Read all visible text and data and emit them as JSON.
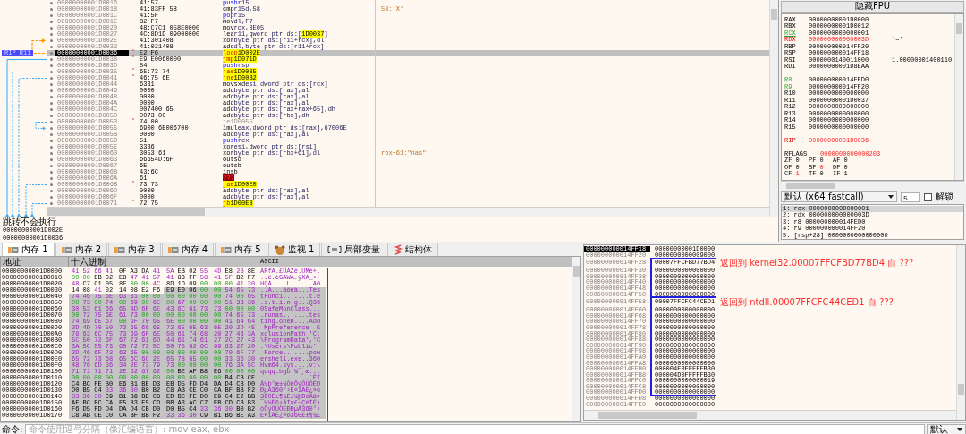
{
  "disassembly": {
    "rip_label": "RIP R11",
    "rows": [
      {
        "address": "00000000001D0016",
        "bytes": "41:57",
        "mnemonic": "push",
        "operands": "r15",
        "kind": "stack",
        "selected": false
      },
      {
        "address": "00000000001D0018",
        "bytes": "41:83FF 58",
        "mnemonic": "cmp",
        "operands": "r15d,58",
        "kind": "plain",
        "selected": false,
        "comment": "58:'X'"
      },
      {
        "address": "00000000001D001C",
        "bytes": "41:5F",
        "mnemonic": "pop",
        "operands": "r15",
        "kind": "stack",
        "selected": false
      },
      {
        "address": "00000000001D001E",
        "bytes": "B2 F7",
        "mnemonic": "mov",
        "operands": "dl,F7",
        "kind": "plain",
        "selected": false
      },
      {
        "address": "00000000001D0020",
        "bytes": "48:C7C1 058E0000",
        "mnemonic": "mov",
        "operands": "rcx,8E05",
        "kind": "plain",
        "selected": false
      },
      {
        "address": "00000000001D0027",
        "bytes": "4C:8D1D 09000000",
        "mnemonic": "lea",
        "operands": "r11,qword ptr ds:[",
        "target": "1D0037",
        "suffix": "]",
        "kind": "plain",
        "selected": false
      },
      {
        "address": "00000000001D002E",
        "bytes": "41:301408",
        "mnemonic": "xor",
        "operands": "byte ptr ds:[r11+rcx],dl",
        "kind": "plain",
        "selected": false
      },
      {
        "address": "00000000001D0032",
        "bytes": "41:021408",
        "mnemonic": "add",
        "operands": "dl,byte ptr ds:[r11+rcx]",
        "kind": "plain",
        "selected": false
      },
      {
        "address": "00000000001D0036",
        "bytes": "E2 F6",
        "mnemonic": "loop",
        "target": "1D002E",
        "kind": "jump",
        "branch": "˄",
        "selected": true
      },
      {
        "address": "00000000001D0038",
        "bytes": "E9 E0060000",
        "mnemonic": "jmp",
        "target": "1D071D",
        "kind": "jump",
        "branch": "˅",
        "selected": false
      },
      {
        "address": "00000000001D003D",
        "bytes": "54",
        "mnemonic": "push",
        "operands": "rsp",
        "kind": "stack",
        "selected": false
      },
      {
        "address": "00000000001D003E",
        "bytes": "65:73 74",
        "mnemonic": "jae",
        "target": "1D0085",
        "kind": "jump",
        "branch": "˅",
        "selected": false
      },
      {
        "address": "00000000001D0041",
        "bytes": "46:75 6E",
        "mnemonic": "jne",
        "target": "1D00B2",
        "kind": "jump",
        "branch": "˅",
        "selected": false
      },
      {
        "address": "00000000001D0044",
        "bytes": "6331",
        "mnemonic": "movsxd",
        "operands": "esi,dword ptr ds:[rcx]",
        "kind": "plain",
        "selected": false
      },
      {
        "address": "00000000001D0046",
        "bytes": "0000",
        "mnemonic": "add",
        "operands": "byte ptr ds:[rax],al",
        "kind": "plain",
        "selected": false
      },
      {
        "address": "00000000001D0048",
        "bytes": "0000",
        "mnemonic": "add",
        "operands": "byte ptr ds:[rax],al",
        "kind": "plain",
        "selected": false
      },
      {
        "address": "00000000001D004A",
        "bytes": "0000",
        "mnemonic": "add",
        "operands": "byte ptr ds:[rax],al",
        "kind": "plain",
        "selected": false
      },
      {
        "address": "00000000001D004C",
        "bytes": "007400 65",
        "mnemonic": "add",
        "operands": "byte ptr ds:[rax+rax+65],dh",
        "kind": "plain",
        "selected": false
      },
      {
        "address": "00000000001D0050",
        "bytes": "0073 00",
        "mnemonic": "add",
        "operands": "byte ptr ds:[rbx],dh",
        "kind": "plain",
        "selected": false
      },
      {
        "address": "00000000001D0053",
        "bytes": "74 00",
        "mnemonic": "je",
        "operands": "1D0055",
        "kind": "dead_jump",
        "branch": "˅",
        "selected": false
      },
      {
        "address": "00000000001D0055",
        "bytes": "6900 6E006700",
        "mnemonic": "imul",
        "operands": "eax,dword ptr ds:[rax],67006E",
        "kind": "plain",
        "selected": false
      },
      {
        "address": "00000000001D005B",
        "bytes": "0000",
        "mnemonic": "add",
        "operands": "byte ptr ds:[rax],al",
        "kind": "plain",
        "selected": false
      },
      {
        "address": "00000000001D005D",
        "bytes": "51",
        "mnemonic": "push",
        "operands": "rcx",
        "kind": "stack",
        "selected": false
      },
      {
        "address": "00000000001D005E",
        "bytes": "3336",
        "mnemonic": "xor",
        "operands": "esi,dword ptr ds:[rsi]",
        "kind": "plain",
        "selected": false
      },
      {
        "address": "00000000001D0060",
        "bytes": "3053 61",
        "mnemonic": "xor",
        "operands": "byte ptr ds:[rbx+61],dl",
        "kind": "plain",
        "selected": false,
        "comment": "rbx+61:\"nas\""
      },
      {
        "address": "00000000001D0063",
        "bytes": "66654D:6F",
        "mnemonic": "outsd",
        "kind": "plain",
        "selected": false
      },
      {
        "address": "00000000001D0067",
        "bytes": "6E",
        "mnemonic": "outsb",
        "kind": "plain",
        "selected": false
      },
      {
        "address": "00000000001D0068",
        "bytes": "43:6C",
        "mnemonic": "insb",
        "kind": "plain",
        "selected": false
      },
      {
        "address": "00000000001D006A",
        "bytes": "61",
        "mnemonic": "???",
        "kind": "invalid",
        "selected": false
      },
      {
        "address": "00000000001D006B",
        "bytes": "73 73",
        "mnemonic": "jae",
        "target": "1D00E0",
        "kind": "jump",
        "branch": "˅",
        "selected": false
      },
      {
        "address": "00000000001D006D",
        "bytes": "0000",
        "mnemonic": "add",
        "operands": "byte ptr ds:[rax],al",
        "kind": "plain",
        "selected": false
      },
      {
        "address": "00000000001D006F",
        "bytes": "0000",
        "mnemonic": "add",
        "operands": "byte ptr ds:[rax],al",
        "kind": "plain",
        "selected": false
      },
      {
        "address": "00000000001D0071",
        "bytes": "72 75",
        "mnemonic": "jb",
        "target": "1D00E8",
        "kind": "jump",
        "branch": "˅",
        "selected": false
      }
    ]
  },
  "info_panel": {
    "lines": [
      "跳转不会执行",
      "00000000001D002E",
      "00000000001D0036"
    ]
  },
  "registers": {
    "hide_fpu_button": "隐藏FPU",
    "groups": [
      [
        {
          "name": "RAX",
          "value": "00000000001D0000",
          "changed": false,
          "highlighted": false,
          "selected": false
        },
        {
          "name": "RBX",
          "value": "00000000001D0012",
          "changed": false,
          "highlighted": false,
          "selected": false
        },
        {
          "name": "RCX",
          "value": "0000000000000001",
          "changed": false,
          "highlighted": true,
          "selected": true
        },
        {
          "name": "RDX",
          "value": "000000000000003D",
          "comment": "'='",
          "changed": true,
          "highlighted": false,
          "selected": false
        },
        {
          "name": "RBP",
          "value": "000000000014FF20",
          "changed": false,
          "highlighted": false,
          "selected": false
        },
        {
          "name": "RSP",
          "value": "000000000014FF18",
          "changed": false,
          "highlighted": false,
          "selected": false
        },
        {
          "name": "RSI",
          "value": "0000000140011000",
          "comment": "1.00000001400110",
          "changed": false,
          "highlighted": false,
          "selected": false
        },
        {
          "name": "RDI",
          "value": "00000000001D8EAA",
          "changed": false,
          "highlighted": false,
          "selected": false
        }
      ],
      [
        {
          "name": "R8",
          "value": "000000000014FED0",
          "changed": false,
          "highlighted": true,
          "selected": false
        },
        {
          "name": "R9",
          "value": "000000000014FF20",
          "changed": false,
          "highlighted": true,
          "selected": false
        },
        {
          "name": "R10",
          "value": "0000000000000000",
          "changed": false,
          "highlighted": false,
          "selected": false
        },
        {
          "name": "R11",
          "value": "00000000001D0037",
          "changed": false,
          "highlighted": false,
          "selected": false
        },
        {
          "name": "R12",
          "value": "0000000000000000",
          "changed": false,
          "highlighted": false,
          "selected": false
        },
        {
          "name": "R13",
          "value": "0000000000000000",
          "changed": false,
          "highlighted": false,
          "selected": false
        },
        {
          "name": "R14",
          "value": "0000000000000000",
          "changed": false,
          "highlighted": false,
          "selected": false
        },
        {
          "name": "R15",
          "value": "0000000000000000",
          "changed": false,
          "highlighted": false,
          "selected": false
        }
      ],
      [
        {
          "name": "RIP",
          "value": "00000000001D0036",
          "changed": true,
          "highlighted": false,
          "selected": false
        }
      ]
    ],
    "rflags": {
      "name": "RFLAGS",
      "value": "0000000000000203",
      "changed": true
    },
    "flags": [
      {
        "name": "ZF",
        "value": "0",
        "changed": false
      },
      {
        "name": "PF",
        "value": "0",
        "changed": false
      },
      {
        "name": "AF",
        "value": "0",
        "changed": false
      },
      {
        "name": "OF",
        "value": "0",
        "changed": false
      },
      {
        "name": "SF",
        "value": "0",
        "changed": true
      },
      {
        "name": "DF",
        "value": "0",
        "changed": false
      },
      {
        "name": "CF",
        "value": "1",
        "changed": true
      },
      {
        "name": "TF",
        "value": "0",
        "changed": false
      },
      {
        "name": "IF",
        "value": "1",
        "changed": false
      }
    ]
  },
  "call_convention": {
    "dropdown": "默认 (x64 fastcall)",
    "count": "5",
    "unlock": {
      "label": "解锁",
      "checked": false
    },
    "args": [
      {
        "text": "1: rcx 0000000000000001",
        "selected": true
      },
      {
        "text": "2: rdx 000000000000003D",
        "selected": false
      },
      {
        "text": "3: r8 000000000014FED0",
        "selected": false
      },
      {
        "text": "4: r9 000000000014FF20",
        "selected": false
      },
      {
        "text": "5: [rsp+28] 0000000000000000",
        "selected": false
      }
    ]
  },
  "tabs": [
    {
      "label": "内存 1",
      "kind": "memory",
      "selected": true
    },
    {
      "label": "内存 2",
      "kind": "memory",
      "selected": false
    },
    {
      "label": "内存 3",
      "kind": "memory",
      "selected": false
    },
    {
      "label": "内存 4",
      "kind": "memory",
      "selected": false
    },
    {
      "label": "内存 5",
      "kind": "memory",
      "selected": false
    },
    {
      "label": "监视 1",
      "kind": "watch",
      "selected": false
    },
    {
      "label": "局部变量",
      "kind": "locals",
      "selected": false
    },
    {
      "label": "结构体",
      "kind": "struct",
      "selected": false
    }
  ],
  "dump": {
    "columns": [
      "地址",
      "十六进制",
      "ASCII"
    ],
    "rows": [
      {
        "address": "00000000001D0000",
        "hex": [
          {
            "bytes": "41 52 66 41",
            "selected": false
          },
          {
            "bytes": "0F A3 DA 41",
            "selected": false
          },
          {
            "bytes": "5A EB 02 55",
            "selected": false
          },
          {
            "bytes": "4D E8 2B 8E",
            "selected": false
          }
        ],
        "ascii": "ARfA.£ÚAZë.UMè+.",
        "ascii_selected": false
      },
      {
        "address": "00000000001D0010",
        "hex": [
          {
            "bytes": "00 00 EB 02",
            "selected": false
          },
          {
            "bytes": "E8 47 41 57",
            "selected": false
          },
          {
            "bytes": "41 83 FF 58",
            "selected": false
          },
          {
            "bytes": "41 5F B2 F7",
            "selected": false
          }
        ],
        "ascii": "..ë.èGAWA.ÿXA_²÷",
        "ascii_selected": false
      },
      {
        "address": "00000000001D0020",
        "hex": [
          {
            "bytes": "48 C7 C1 05",
            "selected": false
          },
          {
            "bytes": "8E 00 00 4C",
            "selected": false
          },
          {
            "bytes": "8D 1D 09 00",
            "selected": false
          },
          {
            "bytes": "00 00 41 30",
            "selected": false
          }
        ],
        "ascii": "HÇÁ....L......A0",
        "ascii_selected": false
      },
      {
        "address": "00000000001D0030",
        "hex": [
          {
            "bytes": "14 08 41 02",
            "selected": false
          },
          {
            "bytes": "14 08 E2 F6",
            "selected": false
          },
          {
            "bytes": "E9 E0 06 00",
            "selected": true
          },
          {
            "bytes": "00 54 65 73",
            "selected": true
          }
        ],
        "ascii": "..A...âöéà...Tes",
        "ascii_selected": true
      },
      {
        "address": "00000000001D0040",
        "hex": [
          {
            "bytes": "74 46 75 6E",
            "selected": true
          },
          {
            "bytes": "63 31 00 00",
            "selected": true
          },
          {
            "bytes": "00 00 00 00",
            "selected": true
          },
          {
            "bytes": "00 74 00 65",
            "selected": true
          }
        ],
        "ascii": "tFunc1.......t.e",
        "ascii_selected": true
      },
      {
        "address": "00000000001D0050",
        "hex": [
          {
            "bytes": "00 73 00 74",
            "selected": true
          },
          {
            "bytes": "00 69 00 6E",
            "selected": true
          },
          {
            "bytes": "00 67 00 00",
            "selected": true
          },
          {
            "bytes": "00 51 33 36",
            "selected": true
          }
        ],
        "ascii": ".s.t.i.n.g...Q36",
        "ascii_selected": true
      },
      {
        "address": "00000000001D0060",
        "hex": [
          {
            "bytes": "30 53 61 66",
            "selected": true
          },
          {
            "bytes": "65 4D 6F 6E",
            "selected": true
          },
          {
            "bytes": "43 6C 61 73",
            "selected": true
          },
          {
            "bytes": "73 00 00 00",
            "selected": true
          }
        ],
        "ascii": "0SafeMonClass...",
        "ascii_selected": true
      },
      {
        "address": "00000000001D0070",
        "hex": [
          {
            "bytes": "00 72 75 6E",
            "selected": true
          },
          {
            "bytes": "61 73 00 00",
            "selected": true
          },
          {
            "bytes": "00 00 00 00",
            "selected": true
          },
          {
            "bytes": "00 74 65 73",
            "selected": true
          }
        ],
        "ascii": ".runas.......tes",
        "ascii_selected": true
      },
      {
        "address": "00000000001D0080",
        "hex": [
          {
            "bytes": "74 69 6E 67",
            "selected": true
          },
          {
            "bytes": "00 6F 70 65",
            "selected": true
          },
          {
            "bytes": "6E 00 00 00",
            "selected": true
          },
          {
            "bytes": "00 41 64 64",
            "selected": true
          }
        ],
        "ascii": "ting.open....Add",
        "ascii_selected": true
      },
      {
        "address": "00000000001D0090",
        "hex": [
          {
            "bytes": "2D 4D 70 50",
            "selected": true
          },
          {
            "bytes": "72 65 66 65",
            "selected": true
          },
          {
            "bytes": "72 65 6E 63",
            "selected": true
          },
          {
            "bytes": "65 20 2D 45",
            "selected": true
          }
        ],
        "ascii": "-MpPreference -E",
        "ascii_selected": true
      },
      {
        "address": "00000000001D00A0",
        "hex": [
          {
            "bytes": "78 63 6C 75",
            "selected": true
          },
          {
            "bytes": "73 69 6F 6E",
            "selected": true
          },
          {
            "bytes": "50 61 74 68",
            "selected": true
          },
          {
            "bytes": "20 27 43 3A",
            "selected": true
          }
        ],
        "ascii": "xclusionPath 'C:",
        "ascii_selected": true
      },
      {
        "address": "00000000001D00B0",
        "hex": [
          {
            "bytes": "5C 50 72 6F",
            "selected": true
          },
          {
            "bytes": "67 72 61 6D",
            "selected": true
          },
          {
            "bytes": "44 61 74 61",
            "selected": true
          },
          {
            "bytes": "27 2C 27 43",
            "selected": true
          }
        ],
        "ascii": "\\ProgramData','C",
        "ascii_selected": true
      },
      {
        "address": "00000000001D00C0",
        "hex": [
          {
            "bytes": "3A 5C 55 73",
            "selected": true
          },
          {
            "bytes": "65 72 73 5C",
            "selected": true
          },
          {
            "bytes": "50 75 62 6C",
            "selected": true
          },
          {
            "bytes": "69 63 27 20",
            "selected": true
          }
        ],
        "ascii": ":\\Users\\Public'",
        "ascii_selected": true
      },
      {
        "address": "00000000001D00D0",
        "hex": [
          {
            "bytes": "2D 46 6F 72",
            "selected": true
          },
          {
            "bytes": "63 65 00 00",
            "selected": true
          },
          {
            "bytes": "00 00 00 00",
            "selected": true
          },
          {
            "bytes": "00 70 6F 77",
            "selected": true
          }
        ],
        "ascii": "-Force.......pow",
        "ascii_selected": true
      },
      {
        "address": "00000000001D00E0",
        "hex": [
          {
            "bytes": "65 72 73 68",
            "selected": true
          },
          {
            "bytes": "65 6C 6C 2E",
            "selected": true
          },
          {
            "bytes": "65 78 65 00",
            "selected": true
          },
          {
            "bytes": "00 33 36 30",
            "selected": true
          }
        ],
        "ascii": "ershell.exe..360",
        "ascii_selected": true
      },
      {
        "address": "00000000001D00F0",
        "hex": [
          {
            "bytes": "48 76 6D 36",
            "selected": true
          },
          {
            "bytes": "34 2E 73 79",
            "selected": true
          },
          {
            "bytes": "73 00 00 00",
            "selected": true
          },
          {
            "bytes": "00 76 3A 5C",
            "selected": true
          }
        ],
        "ascii": "Hvm64.sys....v:\\",
        "ascii_selected": true
      },
      {
        "address": "00000000001D0100",
        "hex": [
          {
            "bytes": "71 71 71 71",
            "selected": true
          },
          {
            "bytes": "2E 62 67 62",
            "selected": true
          },
          {
            "bytes": "00 BE AF B8",
            "selected": true
          },
          {
            "bytes": "E6 00 00 00",
            "selected": true
          }
        ],
        "ascii": "qqqq.bgb.¾¯¸æ...",
        "ascii_selected": true
      },
      {
        "address": "00000000001D0110",
        "hex": [
          {
            "bytes": "00 00 00 00",
            "selected": true
          },
          {
            "bytes": "00 00 00 00",
            "selected": true
          },
          {
            "bytes": "00 00 00 00",
            "selected": true
          },
          {
            "bytes": "00 B4 CB CE",
            "selected": true
          }
        ],
        "ascii": ".............´ËÎ",
        "ascii_selected": true
      },
      {
        "address": "00000000001D0120",
        "hex": [
          {
            "bytes": "C4 BC FE B0",
            "selected": true
          },
          {
            "bytes": "E6 B1 BE D3",
            "selected": true
          },
          {
            "bytes": "EB D5 FD D4",
            "selected": true
          },
          {
            "bytes": "DA D4 CB D0",
            "selected": true
          }
        ],
        "ascii": "Ä¼þ°æ±¾ÓëÕýÔÚÔËÐ",
        "ascii_selected": true
      },
      {
        "address": "00000000001D0130",
        "hex": [
          {
            "bytes": "D0 B5 C4 33",
            "selected": true
          },
          {
            "bytes": "36 30 B0 B2",
            "selected": true
          },
          {
            "bytes": "C8 AB CE C0",
            "selected": true
          },
          {
            "bytes": "CA BF BB F2",
            "selected": true
          }
        ],
        "ascii": "ÐµÄ360°²È«ÎÀÊ¿»ò",
        "ascii_selected": true
      },
      {
        "address": "00000000001D0140",
        "hex": [
          {
            "bytes": "33 36 30 C9",
            "selected": true
          },
          {
            "bytes": "B1 B6 BE C8",
            "selected": true
          },
          {
            "bytes": "ED BC FE D0",
            "selected": true
          },
          {
            "bytes": "E9 C4 E2 BB",
            "selected": true
          }
        ],
        "ascii": "360É±¶¾Èí¼þÐéÄâ»",
        "ascii_selected": true
      },
      {
        "address": "00000000001D0150",
        "hex": [
          {
            "bytes": "AF BC BC CA",
            "selected": true
          },
          {
            "bytes": "F5 B3 E5 CD",
            "selected": true
          },
          {
            "bytes": "BB A3 AC C7",
            "selected": true
          },
          {
            "bytes": "EB CD CB B3",
            "selected": true
          }
        ],
        "ascii": "¯¼¼Êõ³åÍ»£¬ÇëÍË³",
        "ascii_selected": true
      },
      {
        "address": "00000000001D0160",
        "hex": [
          {
            "bytes": "F6 D5 FD D4",
            "selected": true
          },
          {
            "bytes": "DA D4 CB D0",
            "selected": true
          },
          {
            "bytes": "D0 B5 C4 33",
            "selected": true
          },
          {
            "bytes": "36 30 B0 B2",
            "selected": true
          }
        ],
        "ascii": "öÕýÔÚÔËÐÐµÄ360°²",
        "ascii_selected": true
      },
      {
        "address": "00000000001D0170",
        "hex": [
          {
            "bytes": "C8 AB CE C0",
            "selected": true
          },
          {
            "bytes": "CA BF BB F2",
            "selected": true
          },
          {
            "bytes": "33 36 30 C9",
            "selected": true
          },
          {
            "bytes": "B1 B6 BE A3",
            "selected": true
          }
        ],
        "ascii": "È«ÎÀÊ¿»ò360É±¶¾£",
        "ascii_selected": true
      }
    ]
  },
  "stack": {
    "rows": [
      {
        "address": "000000000014FF18",
        "value": "00000000001D0000",
        "in_frame": false,
        "frame_start": false,
        "frame_end": false,
        "selected": true
      },
      {
        "address": "000000000014FF20",
        "value": "0000000000009000",
        "in_frame": false,
        "frame_start": false,
        "frame_end": false,
        "selected": false
      },
      {
        "address": "000000000014FF28",
        "value": "00007FFCFBD77BD4",
        "comment": "返回到 kernel32.00007FFCFBD77BD4 自 ???",
        "in_frame": true,
        "frame_start": true,
        "frame_end": false,
        "selected": false
      },
      {
        "address": "000000000014FF30",
        "value": "0000000000000000",
        "in_frame": true,
        "frame_start": false,
        "frame_end": false,
        "selected": false
      },
      {
        "address": "000000000014FF38",
        "value": "0000000000000000",
        "in_frame": true,
        "frame_start": false,
        "frame_end": false,
        "selected": false
      },
      {
        "address": "000000000014FF40",
        "value": "0000000000000000",
        "in_frame": true,
        "frame_start": false,
        "frame_end": false,
        "selected": false
      },
      {
        "address": "000000000014FF48",
        "value": "0000000000000000",
        "in_frame": true,
        "frame_start": false,
        "frame_end": false,
        "selected": false
      },
      {
        "address": "000000000014FF50",
        "value": "0000000000000000",
        "in_frame": true,
        "frame_start": false,
        "frame_end": true,
        "selected": false
      },
      {
        "address": "000000000014FF58",
        "value": "00007FFCFC44CED1",
        "comment": "返回到 ntdll.00007FFCFC44CED1 自 ???",
        "in_frame": true,
        "frame_start": true,
        "frame_end": false,
        "selected": false
      },
      {
        "address": "000000000014FF60",
        "value": "0000000000000000",
        "in_frame": true,
        "frame_start": false,
        "frame_end": false,
        "selected": false
      },
      {
        "address": "000000000014FF68",
        "value": "0000000000000000",
        "in_frame": true,
        "frame_start": false,
        "frame_end": false,
        "selected": false
      },
      {
        "address": "000000000014FF70",
        "value": "0000000000000000",
        "in_frame": true,
        "frame_start": false,
        "frame_end": false,
        "selected": false
      },
      {
        "address": "000000000014FF78",
        "value": "0000000000000000",
        "in_frame": true,
        "frame_start": false,
        "frame_end": false,
        "selected": false
      },
      {
        "address": "000000000014FF80",
        "value": "0000000000000000",
        "in_frame": true,
        "frame_start": false,
        "frame_end": false,
        "selected": false
      },
      {
        "address": "000000000014FF88",
        "value": "0000000000000000",
        "in_frame": true,
        "frame_start": false,
        "frame_end": false,
        "selected": false
      },
      {
        "address": "000000000014FF90",
        "value": "0000000000000000",
        "in_frame": true,
        "frame_start": false,
        "frame_end": false,
        "selected": false
      },
      {
        "address": "000000000014FF98",
        "value": "0000000000000000",
        "in_frame": true,
        "frame_start": false,
        "frame_end": false,
        "selected": false
      },
      {
        "address": "000000000014FFA0",
        "value": "0000000000000000",
        "in_frame": true,
        "frame_start": false,
        "frame_end": false,
        "selected": false
      },
      {
        "address": "000000000014FFA8",
        "value": "0000000000000000",
        "in_frame": true,
        "frame_start": false,
        "frame_end": false,
        "selected": false
      },
      {
        "address": "000000000014FFB0",
        "value": "000004E8FFFFFB30",
        "in_frame": true,
        "frame_start": false,
        "frame_end": false,
        "selected": false
      },
      {
        "address": "000000000014FFB8",
        "value": "000004D0FFFFFB30",
        "in_frame": true,
        "frame_start": false,
        "frame_end": false,
        "selected": false
      },
      {
        "address": "000000000014FFC0",
        "value": "0000000000000019",
        "in_frame": true,
        "frame_start": false,
        "frame_end": false,
        "selected": false
      },
      {
        "address": "000000000014FFC8",
        "value": "0000000000000000",
        "in_frame": true,
        "frame_start": false,
        "frame_end": false,
        "selected": false
      },
      {
        "address": "000000000014FFD0",
        "value": "0000000000000000",
        "in_frame": true,
        "frame_start": false,
        "frame_end": true,
        "selected": false
      },
      {
        "address": "000000000014FFD8",
        "value": "0000000000000000",
        "in_frame": false,
        "frame_start": false,
        "frame_end": false,
        "selected": false
      },
      {
        "address": "000000000014FFE0",
        "value": "0000000000000000",
        "in_frame": false,
        "frame_start": false,
        "frame_end": false,
        "selected": false
      }
    ]
  },
  "command_bar": {
    "label": "命令:",
    "placeholder": "命令使用逗号分隔（像汇编语言）: mov eax, ebx",
    "mode": "默认"
  }
}
